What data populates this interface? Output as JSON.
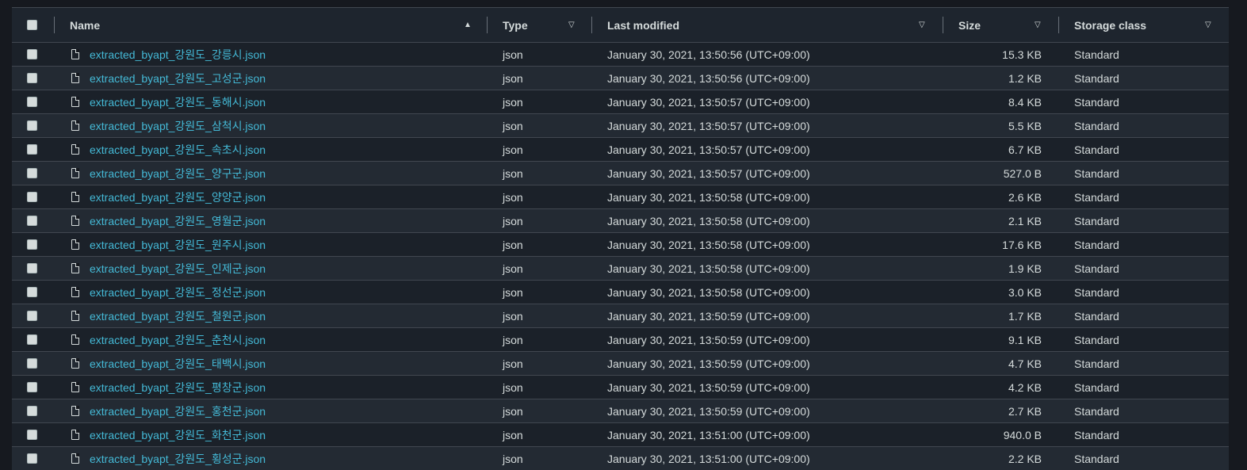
{
  "columns": {
    "name": "Name",
    "type": "Type",
    "last_modified": "Last modified",
    "size": "Size",
    "storage_class": "Storage class"
  },
  "sort": {
    "name_icon": "sort-ascending-icon",
    "other_icon": "sort-descending-outline-icon"
  },
  "rows": [
    {
      "name": "extracted_byapt_강원도_강릉시.json",
      "type": "json",
      "modified": "January 30, 2021, 13:50:56 (UTC+09:00)",
      "size": "15.3 KB",
      "class": "Standard"
    },
    {
      "name": "extracted_byapt_강원도_고성군.json",
      "type": "json",
      "modified": "January 30, 2021, 13:50:56 (UTC+09:00)",
      "size": "1.2 KB",
      "class": "Standard"
    },
    {
      "name": "extracted_byapt_강원도_동해시.json",
      "type": "json",
      "modified": "January 30, 2021, 13:50:57 (UTC+09:00)",
      "size": "8.4 KB",
      "class": "Standard"
    },
    {
      "name": "extracted_byapt_강원도_삼척시.json",
      "type": "json",
      "modified": "January 30, 2021, 13:50:57 (UTC+09:00)",
      "size": "5.5 KB",
      "class": "Standard"
    },
    {
      "name": "extracted_byapt_강원도_속초시.json",
      "type": "json",
      "modified": "January 30, 2021, 13:50:57 (UTC+09:00)",
      "size": "6.7 KB",
      "class": "Standard"
    },
    {
      "name": "extracted_byapt_강원도_양구군.json",
      "type": "json",
      "modified": "January 30, 2021, 13:50:57 (UTC+09:00)",
      "size": "527.0 B",
      "class": "Standard"
    },
    {
      "name": "extracted_byapt_강원도_양양군.json",
      "type": "json",
      "modified": "January 30, 2021, 13:50:58 (UTC+09:00)",
      "size": "2.6 KB",
      "class": "Standard"
    },
    {
      "name": "extracted_byapt_강원도_영월군.json",
      "type": "json",
      "modified": "January 30, 2021, 13:50:58 (UTC+09:00)",
      "size": "2.1 KB",
      "class": "Standard"
    },
    {
      "name": "extracted_byapt_강원도_원주시.json",
      "type": "json",
      "modified": "January 30, 2021, 13:50:58 (UTC+09:00)",
      "size": "17.6 KB",
      "class": "Standard"
    },
    {
      "name": "extracted_byapt_강원도_인제군.json",
      "type": "json",
      "modified": "January 30, 2021, 13:50:58 (UTC+09:00)",
      "size": "1.9 KB",
      "class": "Standard"
    },
    {
      "name": "extracted_byapt_강원도_정선군.json",
      "type": "json",
      "modified": "January 30, 2021, 13:50:58 (UTC+09:00)",
      "size": "3.0 KB",
      "class": "Standard"
    },
    {
      "name": "extracted_byapt_강원도_철원군.json",
      "type": "json",
      "modified": "January 30, 2021, 13:50:59 (UTC+09:00)",
      "size": "1.7 KB",
      "class": "Standard"
    },
    {
      "name": "extracted_byapt_강원도_춘천시.json",
      "type": "json",
      "modified": "January 30, 2021, 13:50:59 (UTC+09:00)",
      "size": "9.1 KB",
      "class": "Standard"
    },
    {
      "name": "extracted_byapt_강원도_태백시.json",
      "type": "json",
      "modified": "January 30, 2021, 13:50:59 (UTC+09:00)",
      "size": "4.7 KB",
      "class": "Standard"
    },
    {
      "name": "extracted_byapt_강원도_평창군.json",
      "type": "json",
      "modified": "January 30, 2021, 13:50:59 (UTC+09:00)",
      "size": "4.2 KB",
      "class": "Standard"
    },
    {
      "name": "extracted_byapt_강원도_홍천군.json",
      "type": "json",
      "modified": "January 30, 2021, 13:50:59 (UTC+09:00)",
      "size": "2.7 KB",
      "class": "Standard"
    },
    {
      "name": "extracted_byapt_강원도_화천군.json",
      "type": "json",
      "modified": "January 30, 2021, 13:51:00 (UTC+09:00)",
      "size": "940.0 B",
      "class": "Standard"
    },
    {
      "name": "extracted_byapt_강원도_횡성군.json",
      "type": "json",
      "modified": "January 30, 2021, 13:51:00 (UTC+09:00)",
      "size": "2.2 KB",
      "class": "Standard"
    }
  ]
}
